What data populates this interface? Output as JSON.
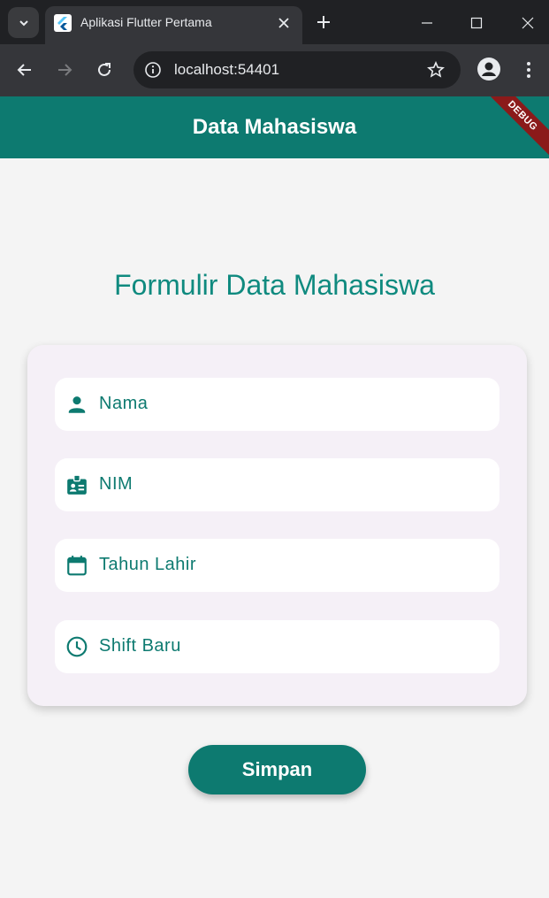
{
  "browser": {
    "tab_title": "Aplikasi Flutter Pertama",
    "url": "localhost:54401"
  },
  "app": {
    "appbar_title": "Data Mahasiswa",
    "debug_banner": "DEBUG",
    "heading": "Formulir Data Mahasiswa",
    "fields": [
      {
        "label": "Nama",
        "icon": "person-icon"
      },
      {
        "label": "NIM",
        "icon": "badge-icon"
      },
      {
        "label": "Tahun Lahir",
        "icon": "calendar-icon"
      },
      {
        "label": "Shift Baru",
        "icon": "clock-icon"
      }
    ],
    "save_label": "Simpan"
  },
  "colors": {
    "primary": "#0d7a70",
    "heading": "#0f8a7f",
    "card": "#f5f0f7",
    "background": "#f4f4f4"
  }
}
